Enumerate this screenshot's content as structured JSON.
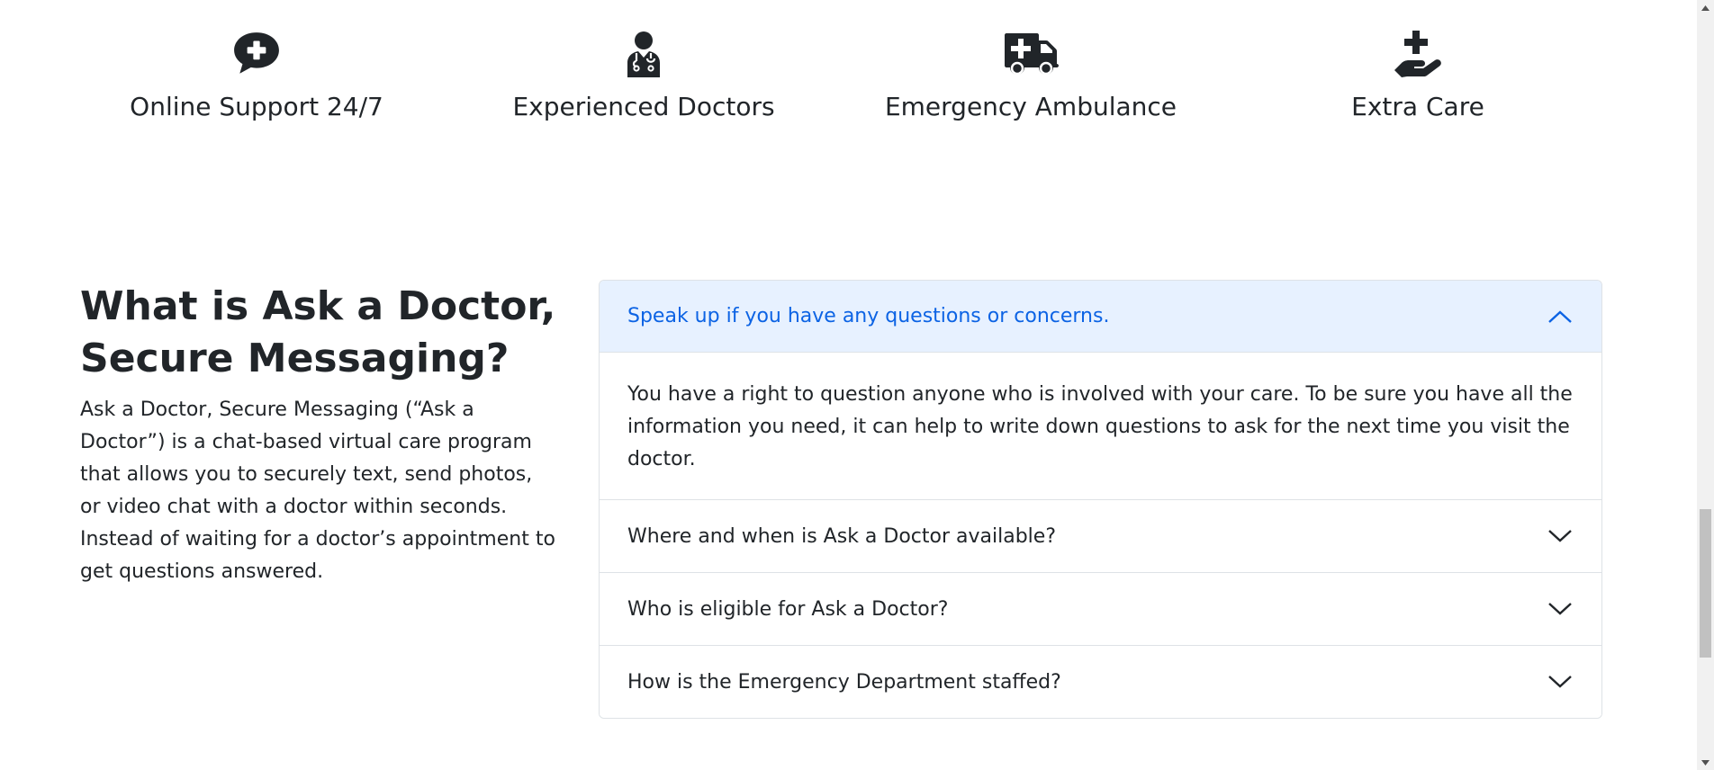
{
  "features": [
    {
      "icon": "chat-plus-icon",
      "label": "Online Support 24/7"
    },
    {
      "icon": "doctor-icon",
      "label": "Experienced Doctors"
    },
    {
      "icon": "ambulance-icon",
      "label": "Emergency Ambulance"
    },
    {
      "icon": "hand-holding-medical-icon",
      "label": "Extra Care"
    }
  ],
  "about": {
    "title": "What is Ask a Doctor, Secure Messaging?",
    "description": "Ask a Doctor, Secure Messaging (“Ask a Doctor”) is a chat-based virtual care program that allows you to securely text, send photos, or video chat with a doctor within seconds. Instead of waiting for a doctor’s appointment to get questions answered."
  },
  "faq": [
    {
      "question": "Speak up if you have any questions or concerns.",
      "answer": "You have a right to question anyone who is involved with your care. To be sure you have all the information you need, it can help to write down questions to ask for the next time you visit the doctor.",
      "expanded": true
    },
    {
      "question": "Where and when is Ask a Doctor available?",
      "expanded": false
    },
    {
      "question": "Who is eligible for Ask a Doctor?",
      "expanded": false
    },
    {
      "question": "How is the Emergency Department staffed?",
      "expanded": false
    }
  ],
  "colors": {
    "text": "#212529",
    "accordion_active_bg": "#e7f1ff",
    "accordion_active_text": "#0c63e4",
    "border": "#dee2e6"
  }
}
